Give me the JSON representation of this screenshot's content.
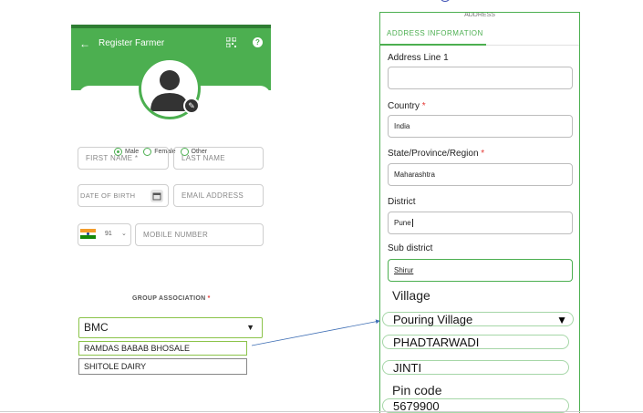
{
  "left": {
    "header_title": "Register Farmer",
    "gender_options": [
      "Male",
      "Female",
      "Other"
    ],
    "gender_selected": "Male",
    "first_name_placeholder": "FIRST NAME *",
    "last_name_placeholder": "LAST NAME",
    "dob_placeholder": "DATE OF BIRTH",
    "email_placeholder": "EMAIL ADDRESS",
    "country_code": "91",
    "mobile_placeholder": "MOBILE NUMBER",
    "group_label": "GROUP ASSOCIATION",
    "group_required": "*",
    "group_selected": "BMC",
    "group_options": [
      "RAMDAS BABAB BHOSALE",
      "SHITOLE DAIRY"
    ]
  },
  "right": {
    "top_heading": "ADDRESS",
    "tab_label": "ADDRESS INFORMATION",
    "address_line1_label": "Address Line 1",
    "address_line1_value": "",
    "country_label": "Country",
    "country_required": "*",
    "country_value": "India",
    "state_label": "State/Province/Region",
    "state_required": "*",
    "state_value": "Maharashtra",
    "district_label": "District",
    "district_value": "Pune",
    "subdistrict_label": "Sub district",
    "subdistrict_value": "Shirur",
    "village_label": "Village",
    "village_selected": "Pouring Village",
    "village_options": [
      "PHADTARWADI",
      "JINTI"
    ],
    "pincode_label": "Pin code",
    "pincode_value": "5679900"
  },
  "colors": {
    "accent": "#4caf50",
    "header_dark": "#2e7d32",
    "required": "#e53935",
    "arrow": "#3f6fb5"
  },
  "icons": {
    "back": "arrow-left-icon",
    "qr": "qr-code-icon",
    "help": "help-icon",
    "avatar": "user-avatar-icon",
    "edit": "pencil-icon",
    "calendar": "calendar-icon",
    "flag": "india-flag-icon",
    "dropdown": "caret-down-icon"
  }
}
